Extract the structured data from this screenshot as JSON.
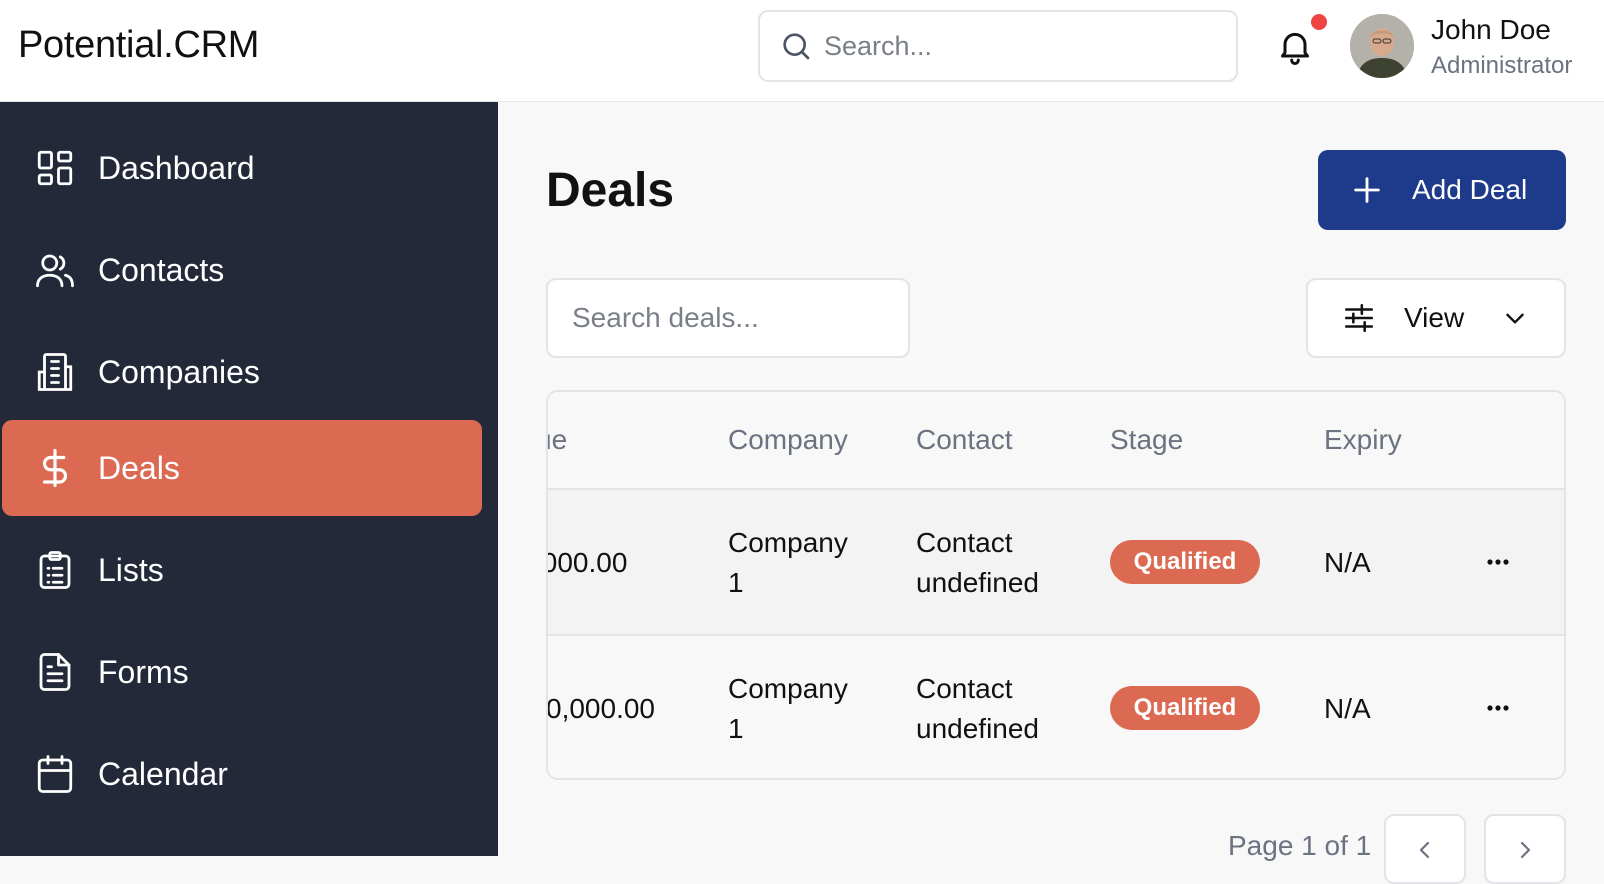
{
  "app": {
    "brand": "Potential.CRM"
  },
  "header": {
    "search_placeholder": "Search...",
    "user": {
      "name": "John Doe",
      "role": "Administrator"
    }
  },
  "sidebar": {
    "items": [
      {
        "label": "Dashboard",
        "icon": "dashboard-icon"
      },
      {
        "label": "Contacts",
        "icon": "users-icon"
      },
      {
        "label": "Companies",
        "icon": "building-icon"
      },
      {
        "label": "Deals",
        "icon": "dollar-icon",
        "active": true
      },
      {
        "label": "Lists",
        "icon": "clipboard-list-icon"
      },
      {
        "label": "Forms",
        "icon": "document-icon"
      },
      {
        "label": "Calendar",
        "icon": "calendar-icon"
      }
    ]
  },
  "main": {
    "title": "Deals",
    "add_button": "Add Deal",
    "search_placeholder": "Search deals...",
    "view_button": "View",
    "table": {
      "columns": [
        "ue",
        "Company",
        "Contact",
        "Stage",
        "Expiry"
      ],
      "rows": [
        {
          "value": ",000.00",
          "company": "Company 1",
          "contact": "Contact undefined",
          "stage": "Qualified",
          "expiry": "N/A"
        },
        {
          "value": "0,000.00",
          "company": "Company 1",
          "contact": "Contact undefined",
          "stage": "Qualified",
          "expiry": "N/A"
        }
      ]
    },
    "pagination": {
      "text": "Page 1 of 1"
    }
  },
  "colors": {
    "sidebar_bg": "#232938",
    "accent": "#dc6a52",
    "primary_button": "#1e3a8a",
    "notification_dot": "#ef4444"
  }
}
